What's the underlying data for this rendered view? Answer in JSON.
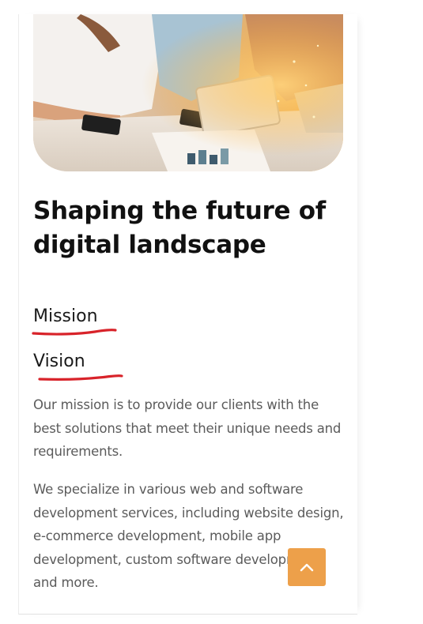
{
  "hero": {
    "image_icon": "team-tablet-photo"
  },
  "content": {
    "heading": "Shaping the future of digital landscape",
    "tabs": [
      {
        "label": "Mission",
        "active": true
      },
      {
        "label": "Vision",
        "active": false
      }
    ],
    "paragraphs": [
      "Our mission is to provide our clients with the best solutions that meet their unique needs and requirements.",
      "We specialize in various web and software development services, including website design, e-commerce development, mobile app development, custom software development, and more."
    ]
  },
  "scroll_top": {
    "icon": "chevron-up-icon"
  },
  "colors": {
    "underline": "#d8232a",
    "scroll_button": "#eda04a",
    "heading": "#111111",
    "body_text": "#5b5b5b"
  }
}
